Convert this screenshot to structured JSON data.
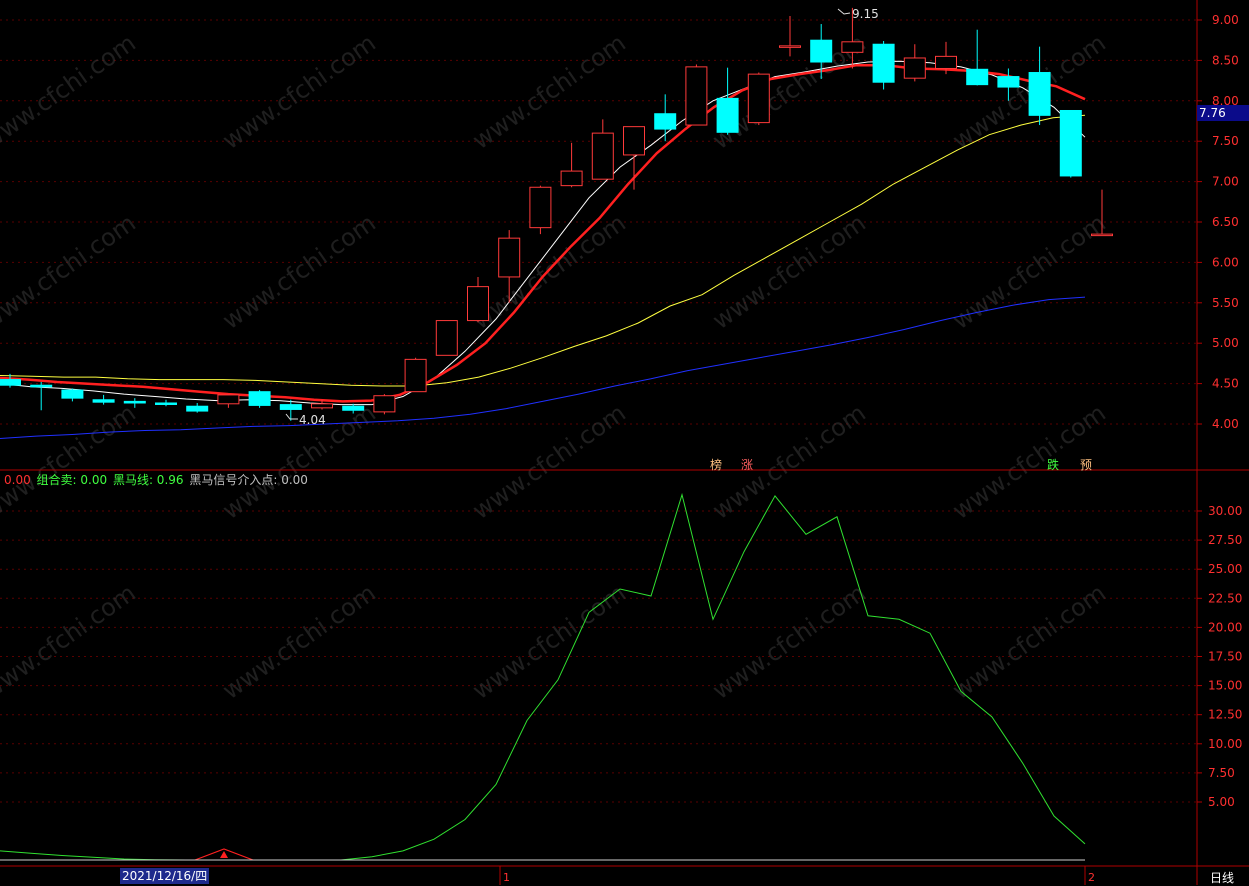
{
  "chart_data": [
    {
      "type": "candlestick",
      "y_ticks": [
        "9.00",
        "8.50",
        "8.00",
        "7.50",
        "7.00",
        "6.50",
        "6.00",
        "5.50",
        "5.00",
        "4.50",
        "4.00"
      ],
      "ylim": [
        3.6,
        9.25
      ],
      "candles": [
        {
          "o": 4.55,
          "h": 4.62,
          "l": 4.45,
          "c": 4.48
        },
        {
          "o": 4.48,
          "h": 4.52,
          "l": 4.17,
          "c": 4.46
        },
        {
          "o": 4.42,
          "h": 4.44,
          "l": 4.28,
          "c": 4.32
        },
        {
          "o": 4.3,
          "h": 4.36,
          "l": 4.24,
          "c": 4.27
        },
        {
          "o": 4.28,
          "h": 4.32,
          "l": 4.2,
          "c": 4.26
        },
        {
          "o": 4.26,
          "h": 4.3,
          "l": 4.22,
          "c": 4.25
        },
        {
          "o": 4.22,
          "h": 4.26,
          "l": 4.14,
          "c": 4.16
        },
        {
          "o": 4.25,
          "h": 4.34,
          "l": 4.2,
          "c": 4.36
        },
        {
          "o": 4.4,
          "h": 4.42,
          "l": 4.2,
          "c": 4.23
        },
        {
          "o": 4.24,
          "h": 4.3,
          "l": 4.04,
          "c": 4.18
        },
        {
          "o": 4.2,
          "h": 4.3,
          "l": 4.18,
          "c": 4.25
        },
        {
          "o": 4.22,
          "h": 4.25,
          "l": 4.13,
          "c": 4.17
        },
        {
          "o": 4.15,
          "h": 4.37,
          "l": 4.12,
          "c": 4.35
        },
        {
          "o": 4.4,
          "h": 4.82,
          "l": 4.4,
          "c": 4.8
        },
        {
          "o": 4.85,
          "h": 5.28,
          "l": 4.85,
          "c": 5.28
        },
        {
          "o": 5.28,
          "h": 5.82,
          "l": 5.26,
          "c": 5.7
        },
        {
          "o": 5.82,
          "h": 6.4,
          "l": 5.5,
          "c": 6.3
        },
        {
          "o": 6.43,
          "h": 6.95,
          "l": 6.35,
          "c": 6.93
        },
        {
          "o": 6.95,
          "h": 7.48,
          "l": 6.93,
          "c": 7.13
        },
        {
          "o": 7.03,
          "h": 7.77,
          "l": 7.03,
          "c": 7.6
        },
        {
          "o": 7.33,
          "h": 7.68,
          "l": 6.9,
          "c": 7.68
        },
        {
          "o": 7.84,
          "h": 8.08,
          "l": 7.5,
          "c": 7.65
        },
        {
          "o": 7.7,
          "h": 8.45,
          "l": 7.7,
          "c": 8.42
        },
        {
          "o": 8.03,
          "h": 8.41,
          "l": 7.58,
          "c": 7.61
        },
        {
          "o": 7.73,
          "h": 8.35,
          "l": 7.7,
          "c": 8.33
        },
        {
          "o": 8.68,
          "h": 9.05,
          "l": 8.55,
          "c": 8.68
        },
        {
          "o": 8.75,
          "h": 8.95,
          "l": 8.27,
          "c": 8.48
        },
        {
          "o": 8.6,
          "h": 9.15,
          "l": 8.4,
          "c": 8.73
        },
        {
          "o": 8.7,
          "h": 8.74,
          "l": 8.14,
          "c": 8.23
        },
        {
          "o": 8.28,
          "h": 8.7,
          "l": 8.24,
          "c": 8.53
        },
        {
          "o": 8.4,
          "h": 8.73,
          "l": 8.33,
          "c": 8.55
        },
        {
          "o": 8.39,
          "h": 8.88,
          "l": 8.19,
          "c": 8.2
        },
        {
          "o": 8.3,
          "h": 8.4,
          "l": 8.0,
          "c": 8.17
        },
        {
          "o": 8.35,
          "h": 8.67,
          "l": 7.7,
          "c": 7.82
        },
        {
          "o": 7.88,
          "h": 7.88,
          "l": 7.05,
          "c": 7.07
        },
        {
          "o": 6.35,
          "h": 6.9,
          "l": 6.35,
          "c": 6.35
        }
      ],
      "series": [
        {
          "color": "#ffffff",
          "values": [
            4.5,
            4.46,
            4.44,
            4.41,
            4.37,
            4.34,
            4.31,
            4.29,
            4.3,
            4.29,
            4.26,
            4.24,
            4.24,
            4.34,
            4.56,
            4.9,
            5.3,
            5.8,
            6.3,
            6.8,
            7.18,
            7.45,
            7.75,
            8.0,
            8.15,
            8.3,
            8.36,
            8.43,
            8.48,
            8.49,
            8.47,
            8.42,
            8.32,
            8.16,
            7.92,
            7.55
          ]
        },
        {
          "color": "#ff2020",
          "values": [
            4.57,
            4.55,
            4.52,
            4.5,
            4.48,
            4.46,
            4.43,
            4.4,
            4.37,
            4.35,
            4.33,
            4.3,
            4.28,
            4.29,
            4.36,
            4.52,
            4.73,
            5.0,
            5.38,
            5.82,
            6.2,
            6.55,
            6.97,
            7.35,
            7.65,
            7.92,
            8.13,
            8.27,
            8.33,
            8.38,
            8.44,
            8.44,
            8.4,
            8.39,
            8.37,
            8.33,
            8.25,
            8.18,
            8.02
          ]
        },
        {
          "color": "#ffff40",
          "values": [
            4.6,
            4.59,
            4.58,
            4.58,
            4.56,
            4.55,
            4.55,
            4.55,
            4.54,
            4.52,
            4.5,
            4.48,
            4.47,
            4.47,
            4.51,
            4.58,
            4.69,
            4.82,
            4.96,
            5.09,
            5.25,
            5.46,
            5.6,
            5.84,
            6.06,
            6.28,
            6.5,
            6.72,
            6.97,
            7.18,
            7.39,
            7.58,
            7.7,
            7.79,
            7.82
          ]
        },
        {
          "color": "#2030ff",
          "values": [
            3.82,
            3.85,
            3.87,
            3.9,
            3.92,
            3.93,
            3.95,
            3.97,
            3.98,
            4.0,
            4.02,
            4.04,
            4.07,
            4.12,
            4.19,
            4.28,
            4.37,
            4.47,
            4.56,
            4.66,
            4.74,
            4.82,
            4.9,
            4.98,
            5.07,
            5.17,
            5.28,
            5.38,
            5.47,
            5.54,
            5.57
          ]
        }
      ],
      "annotations": {
        "high": "9.15",
        "low": "4.04"
      },
      "last_price": "7.76",
      "tags": [
        {
          "text": "榜",
          "color": "#ffc080"
        },
        {
          "text": "涨",
          "color": "#ff6060"
        },
        {
          "text": "跌",
          "color": "#40ff40"
        },
        {
          "text": "预",
          "color": "#ffc080"
        }
      ]
    },
    {
      "type": "line",
      "y_ticks": [
        "30.00",
        "27.50",
        "25.00",
        "22.50",
        "20.00",
        "17.50",
        "15.00",
        "12.50",
        "10.00",
        "7.50",
        "5.00"
      ],
      "ylim": [
        0,
        32.5
      ],
      "legend": [
        {
          "text": "0.00",
          "color": "#ff3030"
        },
        {
          "text": "组合卖: 0.00",
          "color": "#40ff40"
        },
        {
          "text": "黑马线: 0.96",
          "color": "#40ff40"
        },
        {
          "text": "黑马信号介入点: 0.00",
          "color": "#c0c0c0"
        }
      ],
      "series": [
        {
          "name": "黑马线",
          "color": "#30e030",
          "values": [
            0.8,
            0.6,
            0.4,
            0.25,
            0.1,
            0.05,
            0.0,
            0.0,
            0.0,
            0.0,
            0.0,
            0.0,
            0.3,
            0.8,
            1.8,
            3.5,
            6.5,
            12.0,
            15.5,
            21.3,
            23.3,
            22.7,
            31.4,
            20.7,
            26.5,
            31.3,
            28.0,
            29.5,
            21.0,
            20.7,
            19.5,
            14.5,
            12.3,
            8.3,
            3.8,
            1.4
          ]
        }
      ],
      "signal_marker": "up-arrow"
    }
  ],
  "x_axis": {
    "date_label": "2021/12/16/四",
    "tick_labels": [
      "1",
      "2"
    ],
    "period": "日线"
  },
  "watermark": "www.cfchi.com"
}
